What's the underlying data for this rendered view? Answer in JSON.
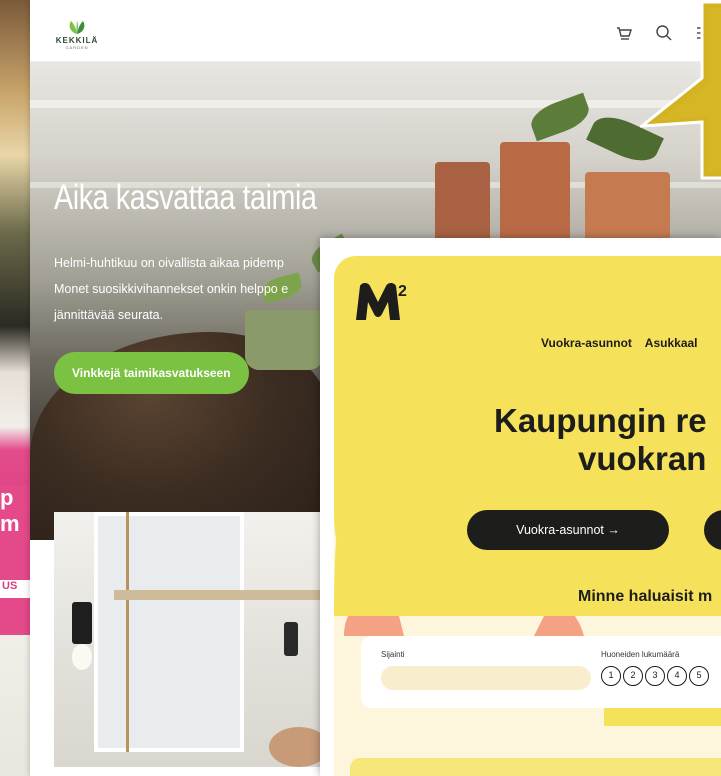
{
  "kekkila": {
    "logo_brand": "KEKKILÄ",
    "logo_sub": "GARDEN",
    "header_icons": [
      "cart-icon",
      "search-icon",
      "menu-icon"
    ],
    "hero_title": "Aika kasvattaa taimia",
    "hero_lines": [
      "Helmi-huhtikuu on oivallista aikaa pidemp",
      "Monet suosikkivihannekset onkin helppo e",
      "jännittävää seurata."
    ],
    "hero_button": "Vinkkejä taimikasvatukseen",
    "colors": {
      "accent_green": "#7cc242"
    }
  },
  "m2": {
    "nav_items": [
      "Vuokra-asunnot",
      "Asukkaal"
    ],
    "headline_line1": "Kaupungin re",
    "headline_line2": "vuokran",
    "button_primary": "Vuokra-asunnot →",
    "question": "Minne haluaisit m",
    "search": {
      "location_label": "Sijainti",
      "rooms_label": "Huoneiden lukumäärä",
      "rooms": [
        "1",
        "2",
        "3",
        "4",
        "5"
      ]
    },
    "colors": {
      "yellow": "#f6e25a",
      "salmon": "#f59a7e",
      "cream": "#fdf6dc",
      "dark": "#1d1d1b"
    }
  },
  "background": {
    "left_text": "p\nm",
    "left_button": "US"
  }
}
